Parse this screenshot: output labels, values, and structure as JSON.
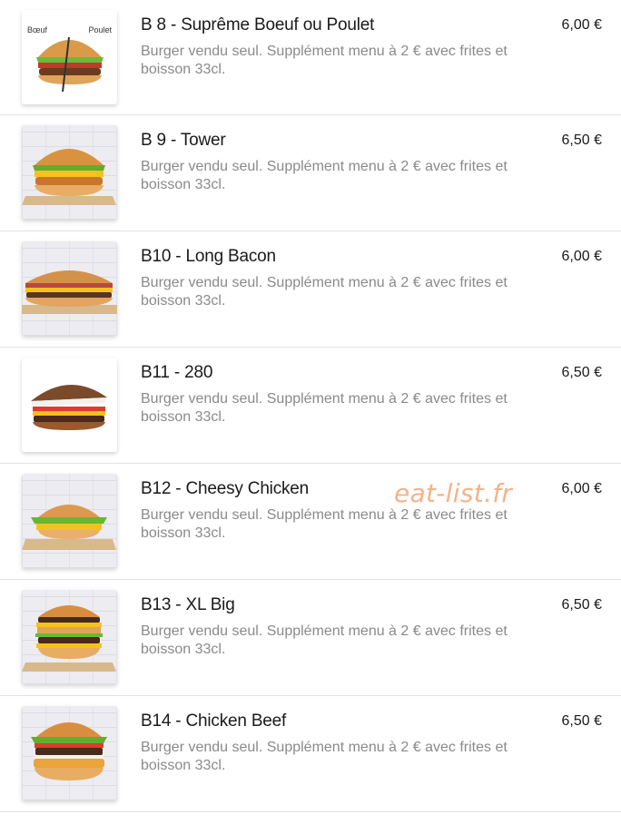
{
  "items": [
    {
      "title": "B 8 - Suprême Boeuf ou Poulet",
      "description": "Burger vendu seul. Supplément menu à 2 € avec frites et boisson 33cl.",
      "price": "6,00 €",
      "image_labels": {
        "left": "Bœuf",
        "right": "Poulet"
      }
    },
    {
      "title": "B 9 - Tower",
      "description": "Burger vendu seul. Supplément menu à 2 € avec frites et boisson 33cl.",
      "price": "6,50 €"
    },
    {
      "title": "B10 - Long Bacon",
      "description": "Burger vendu seul. Supplément menu à 2 € avec frites et boisson 33cl.",
      "price": "6,00 €"
    },
    {
      "title": "B11 - 280",
      "description": "Burger vendu seul. Supplément menu à 2 € avec frites et boisson 33cl.",
      "price": "6,50 €"
    },
    {
      "title": "B12 - Cheesy Chicken",
      "description": "Burger vendu seul. Supplément menu à 2 € avec frites et boisson 33cl.",
      "price": "6,00 €"
    },
    {
      "title": "B13 - XL Big",
      "description": "Burger vendu seul. Supplément menu à 2 € avec frites et boisson 33cl.",
      "price": "6,50 €"
    },
    {
      "title": "B14 - Chicken Beef",
      "description": "Burger vendu seul. Supplément menu à 2 € avec frites et boisson 33cl.",
      "price": "6,50 €"
    }
  ],
  "watermark": "eat-list.fr",
  "colors": {
    "title": "#1a1a1a",
    "description": "#8a8a8a",
    "divider": "#e2e2e2",
    "watermark": "#f3b38a"
  },
  "icons": [
    "burger-photo"
  ]
}
